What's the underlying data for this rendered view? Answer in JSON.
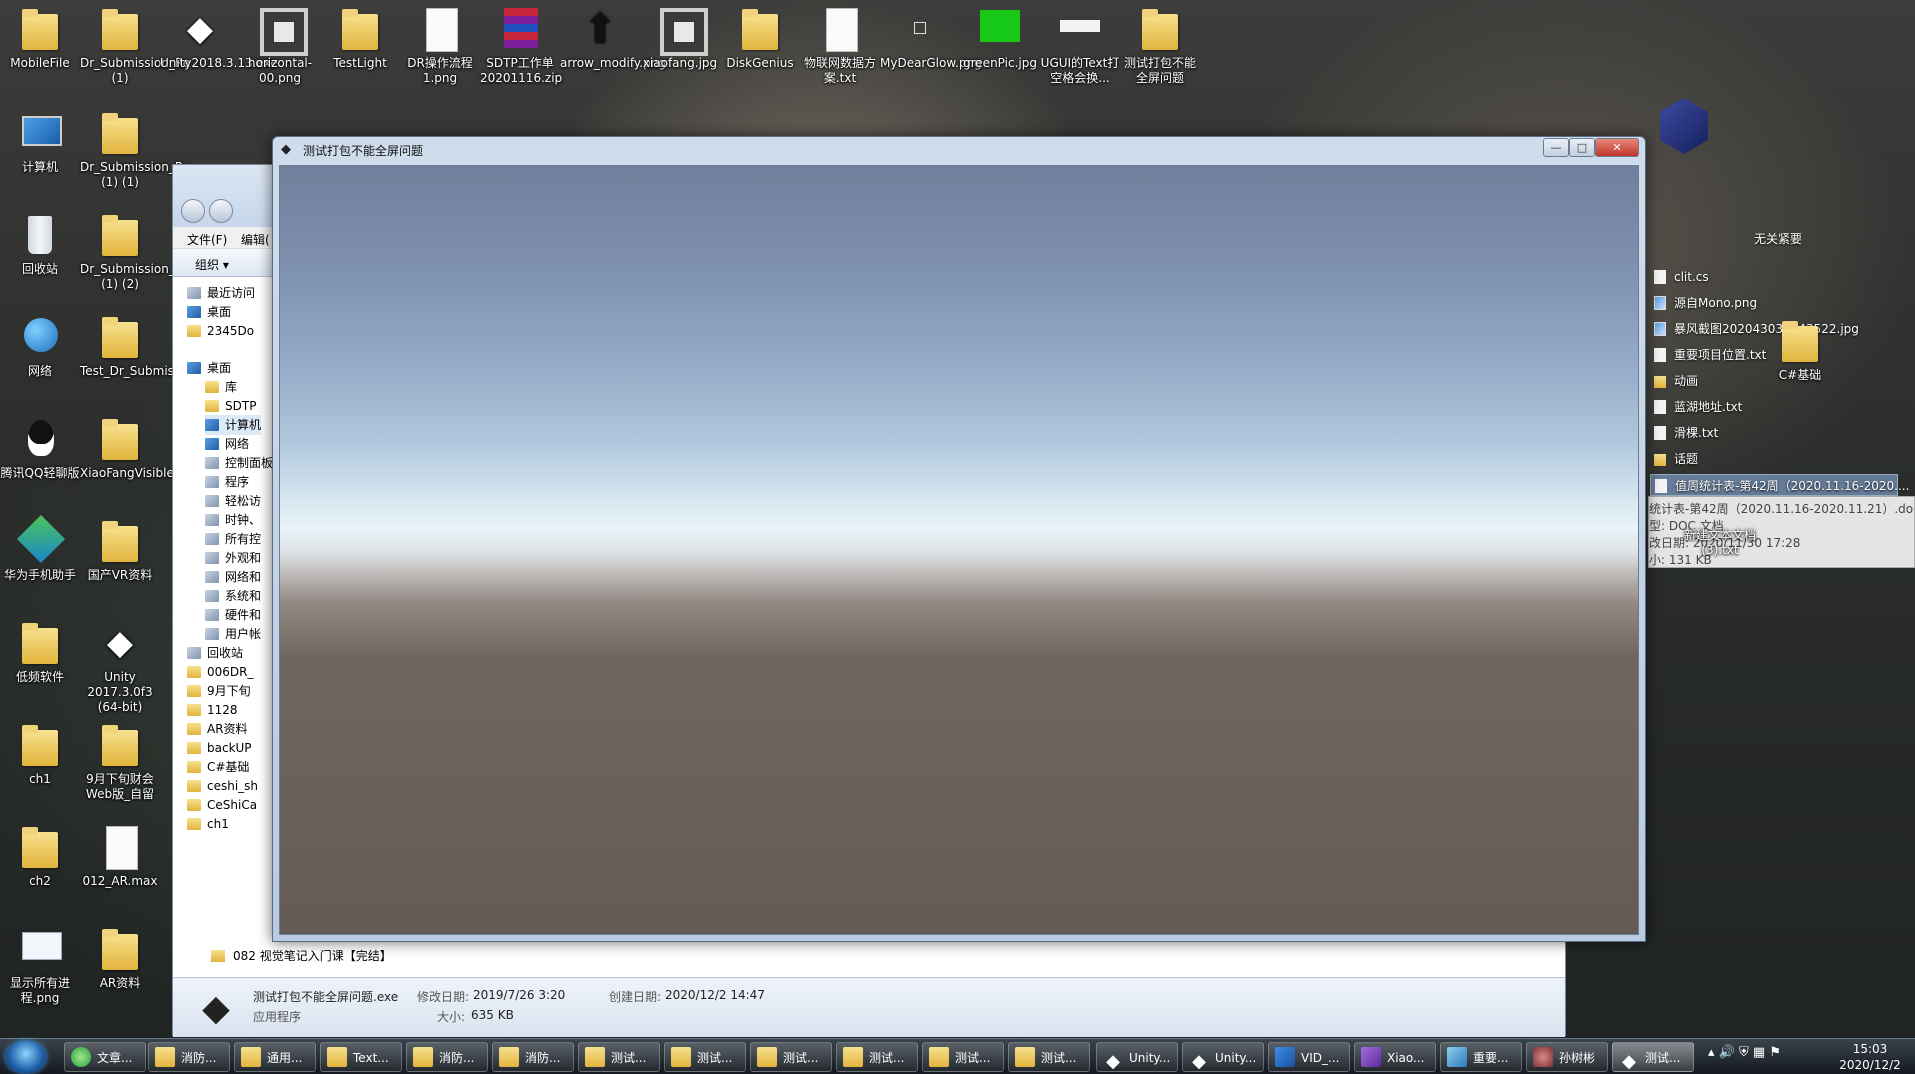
{
  "desktop": {
    "icons": [
      {
        "label": "MobileFile",
        "type": "folder"
      },
      {
        "label": "Dr_Submission_Re (1)",
        "type": "folder"
      },
      {
        "label": "Unity2018.3.13.exe",
        "type": "unity"
      },
      {
        "label": "horizontal-00.png",
        "type": "image"
      },
      {
        "label": "TestLight",
        "type": "folder"
      },
      {
        "label": "DR操作流程1.png",
        "type": "doc"
      },
      {
        "label": "SDTP工作单20201116.zip",
        "type": "zip"
      },
      {
        "label": "arrow_modify.png",
        "type": "arrow"
      },
      {
        "label": "xiaofang.jpg",
        "type": "image"
      },
      {
        "label": "DiskGenius",
        "type": "folder"
      },
      {
        "label": "物联网数据方案.txt",
        "type": "doc"
      },
      {
        "label": "MyDearGlow.png",
        "type": "small"
      },
      {
        "label": "greenPic.jpg",
        "type": "green"
      },
      {
        "label": "UGUI的Text打空格会换...",
        "type": "white"
      },
      {
        "label": "测试打包不能全屏问题",
        "type": "folder"
      },
      {
        "label": "计算机",
        "type": "pc"
      },
      {
        "label": "Dr_Submission_Re (1) (1)",
        "type": "folder"
      },
      {
        "label": "回收站",
        "type": "bin"
      },
      {
        "label": "Dr_Submission_Re (1) (2)",
        "type": "folder"
      },
      {
        "label": "网络",
        "type": "net"
      },
      {
        "label": "Test_Dr_Submission_02",
        "type": "folder"
      },
      {
        "label": "腾讯QQ轻聊版",
        "type": "qq"
      },
      {
        "label": "XiaoFangVisible",
        "type": "folder"
      },
      {
        "label": "华为手机助手",
        "type": "huawei"
      },
      {
        "label": "国产VR资料",
        "type": "folder"
      },
      {
        "label": "低频软件",
        "type": "folder"
      },
      {
        "label": "Unity 2017.3.0f3 (64-bit)",
        "type": "unity"
      },
      {
        "label": "ch1",
        "type": "folder"
      },
      {
        "label": "9月下旬财会Web版_自留",
        "type": "folder"
      },
      {
        "label": "ch2",
        "type": "folder"
      },
      {
        "label": "012_AR.max",
        "type": "doc"
      },
      {
        "label": "显示所有进程.png",
        "type": "proc"
      },
      {
        "label": "AR资料",
        "type": "folder"
      }
    ]
  },
  "explorer": {
    "menu": {
      "file": "文件(F)",
      "edit": "编辑("
    },
    "toolbar": {
      "organize": "组织 ▾"
    },
    "tree": [
      {
        "label": "最近访问",
        "icon": "gray"
      },
      {
        "label": "桌面",
        "icon": "blue"
      },
      {
        "label": "2345Do",
        "icon": "folder"
      },
      {
        "label": "桌面",
        "icon": "blue"
      },
      {
        "label": "库",
        "icon": "folder"
      },
      {
        "label": "SDTP",
        "icon": "folder"
      },
      {
        "label": "计算机",
        "icon": "blue"
      },
      {
        "label": "网络",
        "icon": "blue"
      },
      {
        "label": "控制面板",
        "icon": "gray"
      },
      {
        "label": "程序",
        "icon": "gray"
      },
      {
        "label": "轻松访",
        "icon": "gray"
      },
      {
        "label": "时钟、",
        "icon": "gray"
      },
      {
        "label": "所有控",
        "icon": "gray"
      },
      {
        "label": "外观和",
        "icon": "gray"
      },
      {
        "label": "网络和",
        "icon": "gray"
      },
      {
        "label": "系统和",
        "icon": "gray"
      },
      {
        "label": "硬件和",
        "icon": "gray"
      },
      {
        "label": "用户帐",
        "icon": "gray"
      },
      {
        "label": "回收站",
        "icon": "gray"
      },
      {
        "label": "006DR_",
        "icon": "folder"
      },
      {
        "label": "9月下旬",
        "icon": "folder"
      },
      {
        "label": "1128",
        "icon": "folder"
      },
      {
        "label": "AR资料",
        "icon": "folder"
      },
      {
        "label": "backUP",
        "icon": "folder"
      },
      {
        "label": "C#基础",
        "icon": "folder"
      },
      {
        "label": "ceshi_sh",
        "icon": "folder"
      },
      {
        "label": "CeShiCa",
        "icon": "folder"
      },
      {
        "label": "ch1",
        "icon": "folder"
      }
    ],
    "bottom_folder": "082 视觉笔记入门课【完结】",
    "status": {
      "filename": "测试打包不能全屏问题.exe",
      "modified_label": "修改日期:",
      "modified": "2019/7/26 3:20",
      "created_label": "创建日期:",
      "created": "2020/12/2 14:47",
      "type": "应用程序",
      "size_label": "大小:",
      "size": "635 KB"
    }
  },
  "right_panel": {
    "header": "无关紧要",
    "items": [
      {
        "label": "clit.cs",
        "icon": "doc"
      },
      {
        "label": "源自Mono.png",
        "icon": "pic"
      },
      {
        "label": "暴风截图2020430335435​22.jpg",
        "icon": "pic"
      },
      {
        "label": "重要项目位置.txt",
        "icon": "doc"
      },
      {
        "label": "动画",
        "icon": "fold"
      },
      {
        "label": "蓝湖地址.txt",
        "icon": "doc"
      },
      {
        "label": "滑棵.txt",
        "icon": "doc"
      },
      {
        "label": "话题",
        "icon": "fold"
      },
      {
        "label": "值周统计表-第42周（2020.11.16-2020....",
        "icon": "doc"
      }
    ],
    "tooltip": [
      "统计表-第42周（2020.11.16-2020.11.21）.doc",
      "型: DOC 文档",
      "改日期: 2020/11/30 17:28",
      "小: 131 KB"
    ],
    "floating": {
      "csharp_label": "C#基础",
      "newtxt_label": "新建文本文档 (3).txt"
    }
  },
  "unity_window": {
    "title": "测试打包不能全屏问题",
    "minimize": "—",
    "maximize": "□",
    "close": "✕"
  },
  "taskbar": {
    "items": [
      {
        "label": "文章...",
        "icon": "ie"
      },
      {
        "label": "消防...",
        "icon": "folder"
      },
      {
        "label": "通用...",
        "icon": "folder"
      },
      {
        "label": "Text...",
        "icon": "folder"
      },
      {
        "label": "消防...",
        "icon": "folder"
      },
      {
        "label": "消防...",
        "icon": "folder"
      },
      {
        "label": "测试...",
        "icon": "folder"
      },
      {
        "label": "测试...",
        "icon": "folder"
      },
      {
        "label": "测试...",
        "icon": "folder"
      },
      {
        "label": "测试...",
        "icon": "folder"
      },
      {
        "label": "测试...",
        "icon": "folder"
      },
      {
        "label": "测试...",
        "icon": "folder"
      },
      {
        "label": "Unity...",
        "icon": "unity"
      },
      {
        "label": "Unity...",
        "icon": "unity"
      },
      {
        "label": "VID_...",
        "icon": "vid"
      },
      {
        "label": "Xiao...",
        "icon": "vs"
      },
      {
        "label": "重要...",
        "icon": "book"
      },
      {
        "label": "孙树彬",
        "icon": "avatar"
      },
      {
        "label": "测试...",
        "icon": "unity"
      }
    ],
    "time": "15:03",
    "date": "2020/12/2"
  }
}
